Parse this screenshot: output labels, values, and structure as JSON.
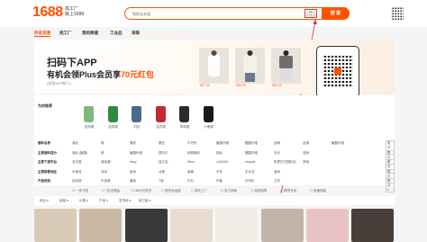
{
  "header": {
    "logo_number": "1688",
    "logo_sub1": "找工厂",
    "logo_sub2": "就上1688",
    "search_placeholder": "搜款连衣裙",
    "search_button": "搜 索"
  },
  "nav": {
    "items": [
      "所有货源",
      "找工厂",
      "我的商铺",
      "工业品",
      "采购"
    ]
  },
  "banner": {
    "title": "扫码下APP",
    "subtitle_pre": "有机会领Plus会员享",
    "subtitle_red": "70元红包",
    "note": "(仅限APP新人)",
    "prices": [
      "¥67.00",
      "¥34.00",
      "¥52.00"
    ]
  },
  "categories": {
    "label": "为你推荐",
    "items": [
      "连衣裙",
      "连衣裙",
      "衬衫",
      "连衣裙",
      "背带裙",
      "小黑裙"
    ],
    "colors": [
      "#7fb87f",
      "#2e8b3e",
      "#4d6a8c",
      "#c7282e",
      "#2b2b2b",
      "#1a1a1a"
    ]
  },
  "filters": [
    {
      "label": "面料名称",
      "options": [
        "涤纶",
        "棉",
        "雪纺",
        "蕾丝",
        "牛仔布",
        "聚酯纤维",
        "醋酸纤维",
        "亚麻",
        "丝绸",
        "聚酯纤维"
      ]
    },
    {
      "label": "主要面料成分",
      "options": [
        "涤纶 (聚酯)",
        "棉",
        "聚酯纤维",
        "莫代尔",
        "纯棉面料",
        "锦纶",
        "醋酸纤维",
        "天丝",
        "亚麻"
      ]
    },
    {
      "label": "主要下游平台",
      "options": [
        "亚马逊",
        "速卖通",
        "ebay",
        "独立站",
        "Wish",
        "LAZADA",
        "shopee",
        "阿里巴巴国际站",
        "其他"
      ]
    },
    {
      "label": "主要销售地区",
      "options": [
        "东南亚",
        "非洲",
        "欧洲",
        "北美",
        "南美",
        "中东",
        "东北亚",
        "澳洲"
      ]
    },
    {
      "label": "产品类别",
      "options": [
        "连衣裙",
        "半身裙",
        "套装",
        "T恤",
        "衬衫",
        "外套",
        "针织衫",
        "卫衣"
      ]
    }
  ],
  "more_label": "更多",
  "checks": [
    "一件代发",
    "7天无理由",
    "48小时发货",
    "退货包运费",
    "源头工厂",
    "实力商家",
    "品质保障",
    "跨境专供",
    "极速退款"
  ],
  "sortbar": [
    "综合",
    "销量",
    "价格",
    "产地",
    "发货地",
    "起订量"
  ],
  "thumbs": {
    "colors": [
      "#d9cbb8",
      "#c9b9a5",
      "#3a3a3a",
      "#e8dcd0",
      "#f2ece6",
      "#c2b4a8",
      "#e8c3c5",
      "#4a3e3a"
    ]
  }
}
